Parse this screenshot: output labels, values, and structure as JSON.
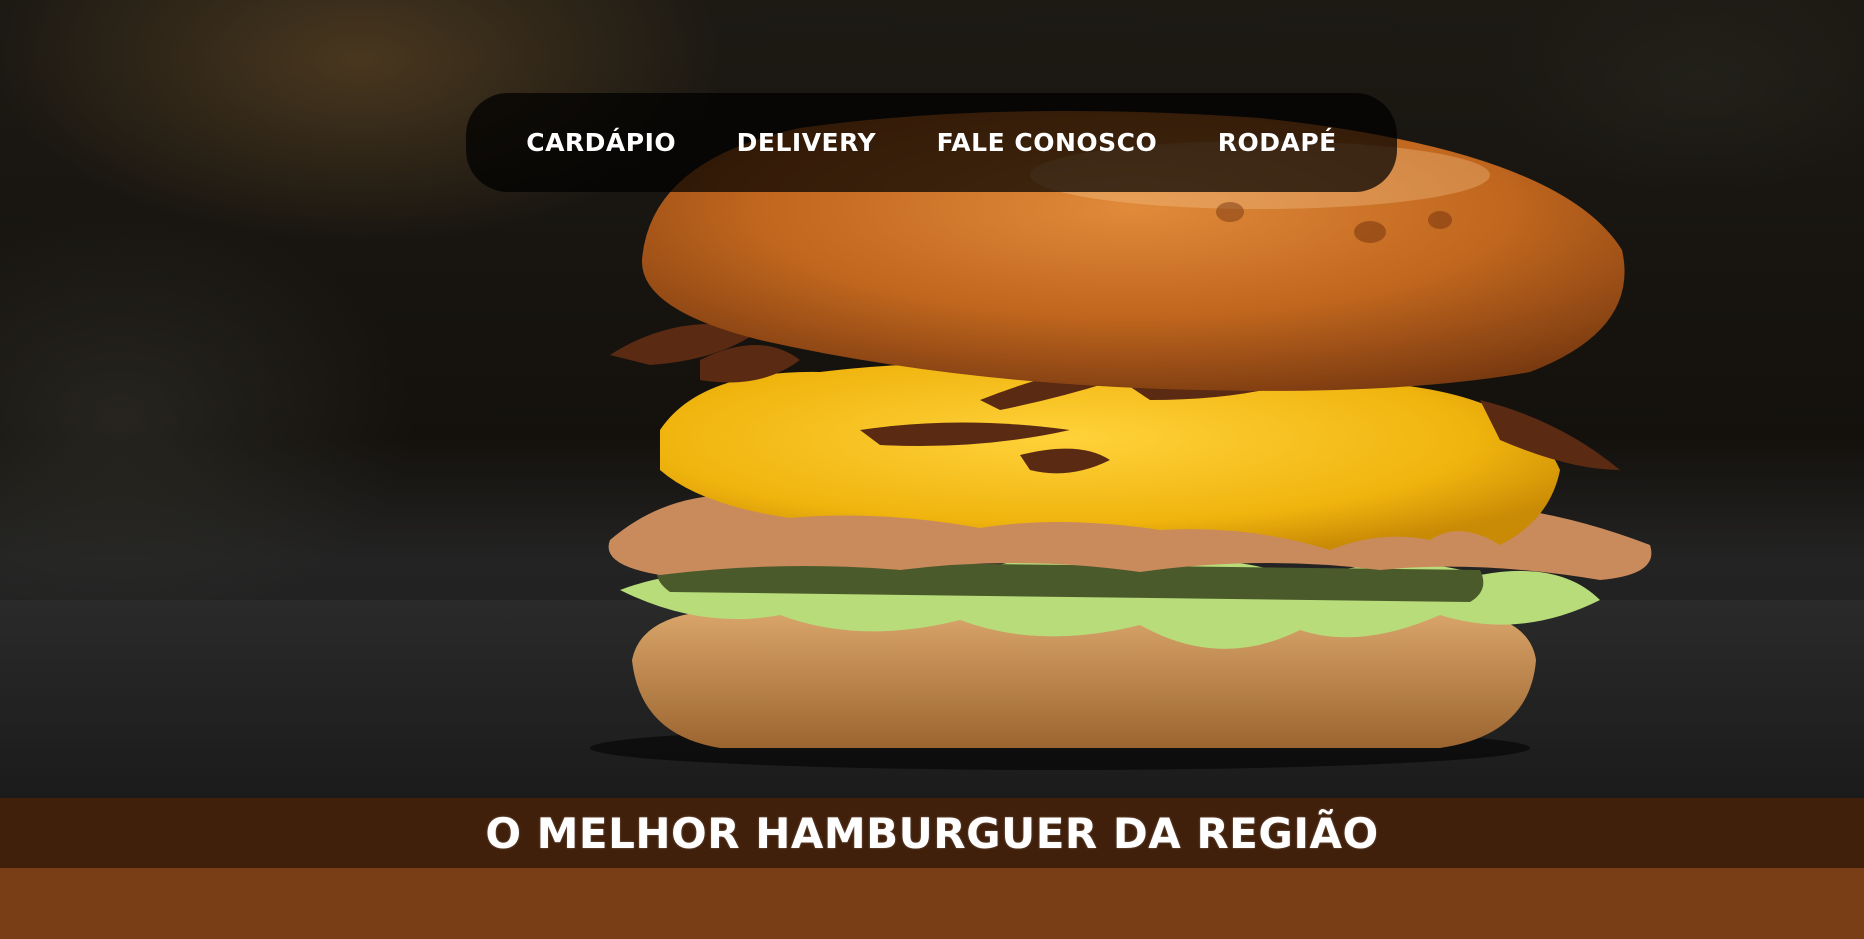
{
  "nav": {
    "items": [
      {
        "label": "CARDÁPIO"
      },
      {
        "label": "DELIVERY"
      },
      {
        "label": "FALE CONOSCO"
      },
      {
        "label": "RODAPÉ"
      }
    ]
  },
  "banner": {
    "title": "O MELHOR HAMBURGUER DA REGIÃO"
  },
  "colors": {
    "banner_bg": "#41200b",
    "footer_bg": "#7a3e16",
    "nav_bg": "rgba(0,0,0,0.72)"
  },
  "hero_image": {
    "subject": "cheeseburger-photo"
  }
}
